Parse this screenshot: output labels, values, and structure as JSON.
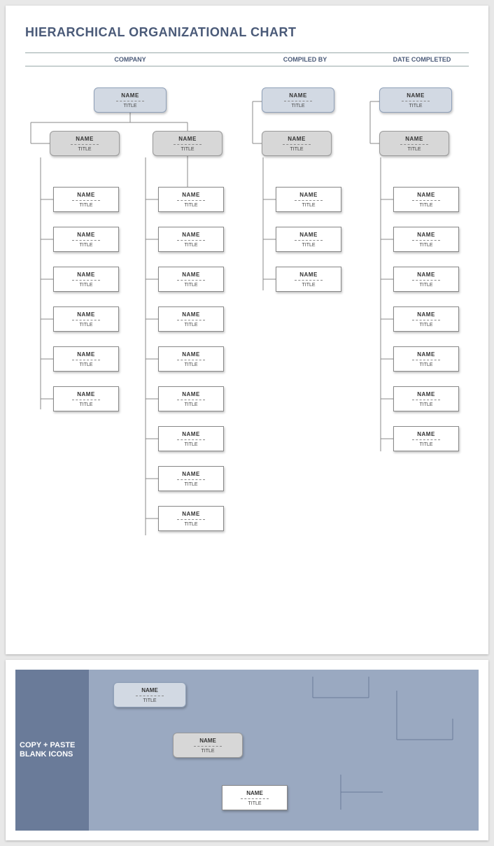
{
  "page_title": "HIERARCHICAL ORGANIZATIONAL CHART",
  "headers": {
    "company": "COMPANY",
    "compiled": "COMPILED BY",
    "date": "DATE COMPLETED"
  },
  "placeholders": {
    "name": "NAME",
    "title": "TITLE"
  },
  "bottom_panel_label": "COPY + PASTE BLANK ICONS",
  "chart_data": {
    "type": "org-chart",
    "branches": [
      {
        "top": {
          "name": "NAME",
          "title": "TITLE"
        },
        "mids": [
          {
            "name": "NAME",
            "title": "TITLE",
            "children_count": 6
          },
          {
            "name": "NAME",
            "title": "TITLE",
            "children_count": 9
          }
        ]
      },
      {
        "top": {
          "name": "NAME",
          "title": "TITLE"
        },
        "mids": [
          {
            "name": "NAME",
            "title": "TITLE",
            "children_count": 3
          }
        ]
      },
      {
        "top": {
          "name": "NAME",
          "title": "TITLE"
        },
        "mids": [
          {
            "name": "NAME",
            "title": "TITLE",
            "children_count": 7
          }
        ]
      }
    ]
  }
}
